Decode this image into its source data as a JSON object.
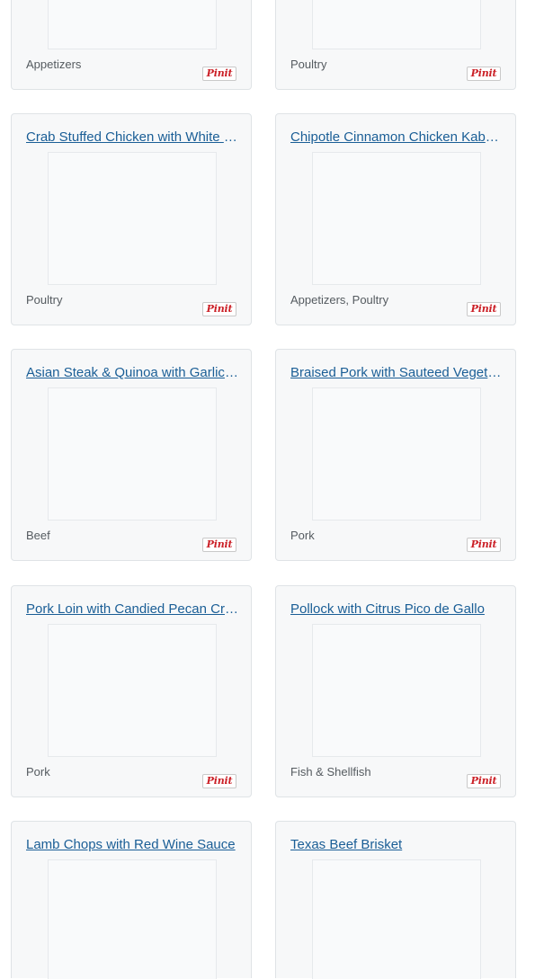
{
  "pin_label": "Pinit",
  "recipes": [
    {
      "title": "",
      "category": "Appetizers"
    },
    {
      "title": "",
      "category": "Poultry"
    },
    {
      "title": "Crab Stuffed Chicken with White Wine Sauce",
      "category": "Poultry"
    },
    {
      "title": "Chipotle Cinnamon Chicken Kabobs",
      "category": "Appetizers, Poultry"
    },
    {
      "title": "Asian Steak & Quinoa with Garlic Green Beans",
      "category": "Beef"
    },
    {
      "title": "Braised Pork with Sauteed Vegetables",
      "category": "Pork"
    },
    {
      "title": "Pork Loin with Candied Pecan Crust",
      "category": "Pork"
    },
    {
      "title": "Pollock with Citrus Pico de Gallo",
      "category": "Fish & Shellfish"
    },
    {
      "title": "Lamb Chops with Red Wine Sauce",
      "category": ""
    },
    {
      "title": "Texas Beef Brisket",
      "category": ""
    }
  ]
}
